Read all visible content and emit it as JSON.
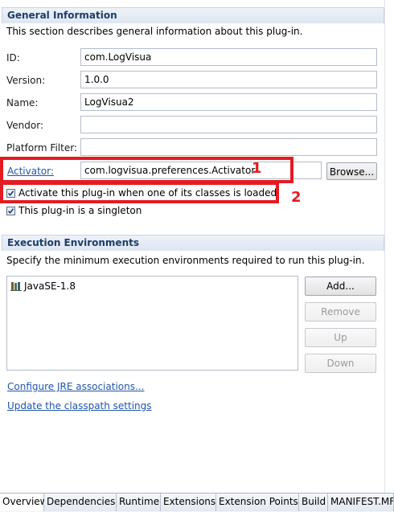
{
  "general": {
    "title": "General Information",
    "description": "This section describes general information about this plug-in.",
    "fields": [
      {
        "label": "ID:",
        "value": ""
      },
      {
        "label": "Version:",
        "value": ""
      },
      {
        "label": "Name:",
        "value": ""
      },
      {
        "label": "Vendor:",
        "value": ""
      },
      {
        "label": "Platform Filter:",
        "value": ""
      }
    ],
    "id_value": "com.LogVisua",
    "version_value": "1.0.0",
    "name_value": "LogVisua2",
    "vendor_value": "",
    "platform_filter_value": "",
    "activator_label": "Activator:",
    "activator_value": "com.logvisua.preferences.Activator",
    "browse_label": "Browse...",
    "activate_checkbox": {
      "label": "Activate this plug-in when one of its classes is loaded",
      "checked": true
    },
    "singleton_checkbox": {
      "label": "This plug-in is a singleton",
      "checked": true
    }
  },
  "annotations": {
    "marker1": "1",
    "marker2": "2",
    "color": "#e31b23"
  },
  "execution": {
    "title": "Execution Environments",
    "description": "Specify the minimum execution environments required to run this plug-in.",
    "environments": [
      "JavaSE-1.8"
    ],
    "add_label": "Add...",
    "remove_label": "Remove",
    "up_label": "Up",
    "down_label": "Down",
    "configure_link": "Configure JRE associations...",
    "update_link": "Update the classpath settings"
  },
  "tabs": [
    "Overview",
    "Dependencies",
    "Runtime",
    "Extensions",
    "Extension Points",
    "Build",
    "MANIFEST.MF"
  ],
  "active_tab": "Overview"
}
